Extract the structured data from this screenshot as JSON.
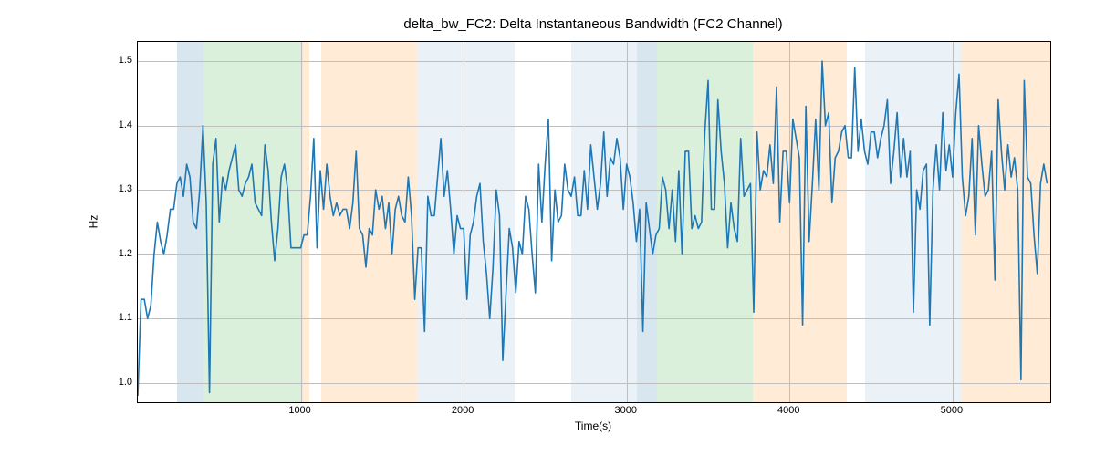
{
  "chart_data": {
    "type": "line",
    "title": "delta_bw_FC2: Delta Instantaneous Bandwidth (FC2 Channel)",
    "xlabel": "Time(s)",
    "ylabel": "Hz",
    "xlim": [
      0,
      5600
    ],
    "ylim": [
      0.97,
      1.53
    ],
    "xticks": [
      1000,
      2000,
      3000,
      4000,
      5000
    ],
    "yticks": [
      1.0,
      1.1,
      1.2,
      1.3,
      1.4,
      1.5
    ],
    "bands": [
      {
        "x0": 240,
        "x1": 405,
        "color": "blue"
      },
      {
        "x0": 405,
        "x1": 1015,
        "color": "green"
      },
      {
        "x0": 1015,
        "x1": 1055,
        "color": "orange"
      },
      {
        "x0": 1125,
        "x1": 1715,
        "color": "orange"
      },
      {
        "x0": 1715,
        "x1": 2310,
        "color": "lightblue"
      },
      {
        "x0": 2660,
        "x1": 3065,
        "color": "lightblue"
      },
      {
        "x0": 3065,
        "x1": 3185,
        "color": "blue"
      },
      {
        "x0": 3185,
        "x1": 3775,
        "color": "green"
      },
      {
        "x0": 3775,
        "x1": 4350,
        "color": "orange"
      },
      {
        "x0": 4465,
        "x1": 5050,
        "color": "lightblue"
      },
      {
        "x0": 5050,
        "x1": 5600,
        "color": "orange"
      }
    ],
    "x": [
      0,
      20,
      40,
      60,
      80,
      100,
      120,
      140,
      160,
      180,
      200,
      220,
      240,
      260,
      280,
      300,
      320,
      340,
      360,
      380,
      400,
      420,
      440,
      460,
      480,
      500,
      520,
      540,
      560,
      580,
      600,
      620,
      640,
      660,
      680,
      700,
      720,
      740,
      760,
      780,
      800,
      820,
      840,
      860,
      880,
      900,
      920,
      940,
      960,
      980,
      1000,
      1020,
      1040,
      1060,
      1080,
      1100,
      1120,
      1140,
      1160,
      1180,
      1200,
      1220,
      1240,
      1260,
      1280,
      1300,
      1320,
      1340,
      1360,
      1380,
      1400,
      1420,
      1440,
      1460,
      1480,
      1500,
      1520,
      1540,
      1560,
      1580,
      1600,
      1620,
      1640,
      1660,
      1680,
      1700,
      1720,
      1740,
      1760,
      1780,
      1800,
      1820,
      1840,
      1860,
      1880,
      1900,
      1920,
      1940,
      1960,
      1980,
      2000,
      2020,
      2040,
      2060,
      2080,
      2100,
      2120,
      2140,
      2160,
      2180,
      2200,
      2220,
      2240,
      2260,
      2280,
      2300,
      2320,
      2340,
      2360,
      2380,
      2400,
      2420,
      2440,
      2460,
      2480,
      2500,
      2520,
      2540,
      2560,
      2580,
      2600,
      2620,
      2640,
      2660,
      2680,
      2700,
      2720,
      2740,
      2760,
      2780,
      2800,
      2820,
      2840,
      2860,
      2880,
      2900,
      2920,
      2940,
      2960,
      2980,
      3000,
      3020,
      3040,
      3060,
      3080,
      3100,
      3120,
      3140,
      3160,
      3180,
      3200,
      3220,
      3240,
      3260,
      3280,
      3300,
      3320,
      3340,
      3360,
      3380,
      3400,
      3420,
      3440,
      3460,
      3480,
      3500,
      3520,
      3540,
      3560,
      3580,
      3600,
      3620,
      3640,
      3660,
      3680,
      3700,
      3720,
      3740,
      3760,
      3780,
      3800,
      3820,
      3840,
      3860,
      3880,
      3900,
      3920,
      3940,
      3960,
      3980,
      4000,
      4020,
      4040,
      4060,
      4080,
      4100,
      4120,
      4140,
      4160,
      4180,
      4200,
      4220,
      4240,
      4260,
      4280,
      4300,
      4320,
      4340,
      4360,
      4380,
      4400,
      4420,
      4440,
      4460,
      4480,
      4500,
      4520,
      4540,
      4560,
      4580,
      4600,
      4620,
      4640,
      4660,
      4680,
      4700,
      4720,
      4740,
      4760,
      4780,
      4800,
      4820,
      4840,
      4860,
      4880,
      4900,
      4920,
      4940,
      4960,
      4980,
      5000,
      5020,
      5040,
      5060,
      5080,
      5100,
      5120,
      5140,
      5160,
      5180,
      5200,
      5220,
      5240,
      5260,
      5280,
      5300,
      5320,
      5340,
      5360,
      5380,
      5400,
      5420,
      5440,
      5460,
      5480,
      5500,
      5520,
      5540,
      5560,
      5580
    ],
    "y": [
      0.98,
      1.13,
      1.13,
      1.1,
      1.12,
      1.2,
      1.25,
      1.22,
      1.2,
      1.23,
      1.27,
      1.27,
      1.31,
      1.32,
      1.29,
      1.34,
      1.32,
      1.25,
      1.24,
      1.3,
      1.4,
      1.28,
      0.985,
      1.34,
      1.38,
      1.25,
      1.32,
      1.3,
      1.33,
      1.35,
      1.37,
      1.3,
      1.29,
      1.31,
      1.32,
      1.34,
      1.28,
      1.27,
      1.26,
      1.37,
      1.33,
      1.25,
      1.19,
      1.24,
      1.32,
      1.34,
      1.3,
      1.21,
      1.21,
      1.21,
      1.21,
      1.23,
      1.23,
      1.29,
      1.38,
      1.21,
      1.33,
      1.27,
      1.34,
      1.29,
      1.26,
      1.28,
      1.26,
      1.27,
      1.27,
      1.24,
      1.28,
      1.36,
      1.24,
      1.23,
      1.18,
      1.24,
      1.23,
      1.3,
      1.27,
      1.29,
      1.24,
      1.28,
      1.2,
      1.27,
      1.29,
      1.26,
      1.25,
      1.32,
      1.26,
      1.13,
      1.21,
      1.21,
      1.08,
      1.29,
      1.26,
      1.26,
      1.32,
      1.38,
      1.29,
      1.33,
      1.27,
      1.2,
      1.26,
      1.24,
      1.24,
      1.13,
      1.23,
      1.25,
      1.29,
      1.31,
      1.22,
      1.17,
      1.1,
      1.18,
      1.3,
      1.26,
      1.035,
      1.14,
      1.24,
      1.21,
      1.14,
      1.22,
      1.2,
      1.29,
      1.27,
      1.2,
      1.14,
      1.34,
      1.25,
      1.34,
      1.41,
      1.19,
      1.3,
      1.25,
      1.26,
      1.34,
      1.3,
      1.29,
      1.32,
      1.26,
      1.26,
      1.33,
      1.27,
      1.37,
      1.32,
      1.27,
      1.31,
      1.39,
      1.29,
      1.35,
      1.34,
      1.38,
      1.35,
      1.27,
      1.34,
      1.32,
      1.28,
      1.22,
      1.27,
      1.08,
      1.28,
      1.24,
      1.2,
      1.23,
      1.24,
      1.32,
      1.3,
      1.24,
      1.3,
      1.22,
      1.33,
      1.2,
      1.36,
      1.36,
      1.24,
      1.26,
      1.24,
      1.25,
      1.39,
      1.47,
      1.27,
      1.27,
      1.44,
      1.36,
      1.31,
      1.21,
      1.28,
      1.24,
      1.22,
      1.38,
      1.29,
      1.3,
      1.31,
      1.11,
      1.39,
      1.3,
      1.33,
      1.32,
      1.37,
      1.31,
      1.46,
      1.25,
      1.36,
      1.36,
      1.28,
      1.41,
      1.38,
      1.35,
      1.09,
      1.43,
      1.22,
      1.31,
      1.41,
      1.3,
      1.5,
      1.4,
      1.42,
      1.28,
      1.35,
      1.36,
      1.39,
      1.4,
      1.35,
      1.35,
      1.49,
      1.36,
      1.41,
      1.36,
      1.34,
      1.39,
      1.39,
      1.35,
      1.38,
      1.4,
      1.44,
      1.31,
      1.36,
      1.42,
      1.32,
      1.38,
      1.32,
      1.36,
      1.11,
      1.3,
      1.27,
      1.33,
      1.34,
      1.09,
      1.3,
      1.37,
      1.3,
      1.42,
      1.33,
      1.37,
      1.32,
      1.42,
      1.48,
      1.32,
      1.26,
      1.29,
      1.38,
      1.23,
      1.4,
      1.34,
      1.29,
      1.3,
      1.36,
      1.16,
      1.44,
      1.36,
      1.3,
      1.37,
      1.32,
      1.35,
      1.3,
      1.005,
      1.47,
      1.32,
      1.31,
      1.23,
      1.17,
      1.31,
      1.34,
      1.31
    ]
  }
}
